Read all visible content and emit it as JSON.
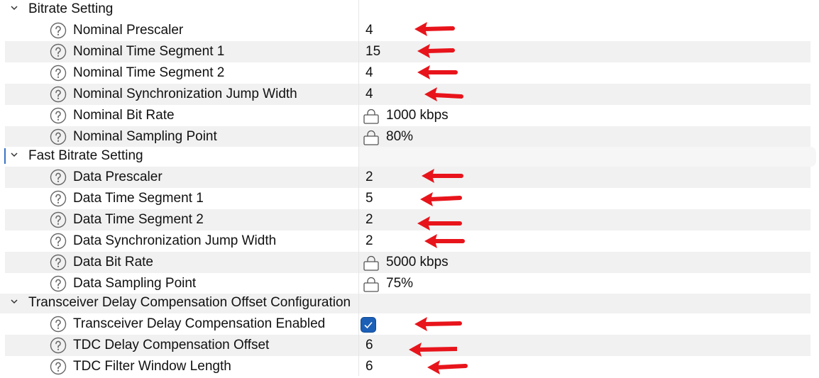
{
  "groups": [
    {
      "label": "Bitrate Setting",
      "params": [
        {
          "label": "Nominal Prescaler",
          "value": "4",
          "locked": false
        },
        {
          "label": "Nominal Time Segment 1",
          "value": "15",
          "locked": false
        },
        {
          "label": "Nominal Time Segment 2",
          "value": "4",
          "locked": false
        },
        {
          "label": "Nominal Synchronization Jump Width",
          "value": "4",
          "locked": false
        },
        {
          "label": "Nominal Bit Rate",
          "value": "1000 kbps",
          "locked": true
        },
        {
          "label": "Nominal Sampling Point",
          "value": "80%",
          "locked": true
        }
      ]
    },
    {
      "label": "Fast Bitrate Setting",
      "params": [
        {
          "label": "Data Prescaler",
          "value": "2",
          "locked": false
        },
        {
          "label": "Data Time Segment 1",
          "value": "5",
          "locked": false
        },
        {
          "label": "Data Time Segment 2",
          "value": "2",
          "locked": false
        },
        {
          "label": "Data Synchronization Jump Width",
          "value": "2",
          "locked": false
        },
        {
          "label": "Data Bit Rate",
          "value": "5000 kbps",
          "locked": true
        },
        {
          "label": "Data Sampling Point",
          "value": "75%",
          "locked": true
        }
      ]
    },
    {
      "label": "Transceiver Delay Compensation Offset Configuration",
      "params": [
        {
          "label": "Transceiver Delay Compensation Enabled",
          "checked": true
        },
        {
          "label": "TDC Delay Compensation Offset",
          "value": "6",
          "locked": false
        },
        {
          "label": "TDC Filter Window Length",
          "value": "6",
          "locked": false
        }
      ]
    }
  ],
  "icons": {
    "expand": "chevron-down-icon",
    "help": "help-circle-icon",
    "lock": "lock-icon",
    "check": "checkmark-icon",
    "annotation": "red-arrow-annotation"
  },
  "colors": {
    "accent": "#1b5fb7",
    "annotation": "#e8141b",
    "alt_row": "#f1f1f1",
    "focus": "#3a74c4"
  }
}
